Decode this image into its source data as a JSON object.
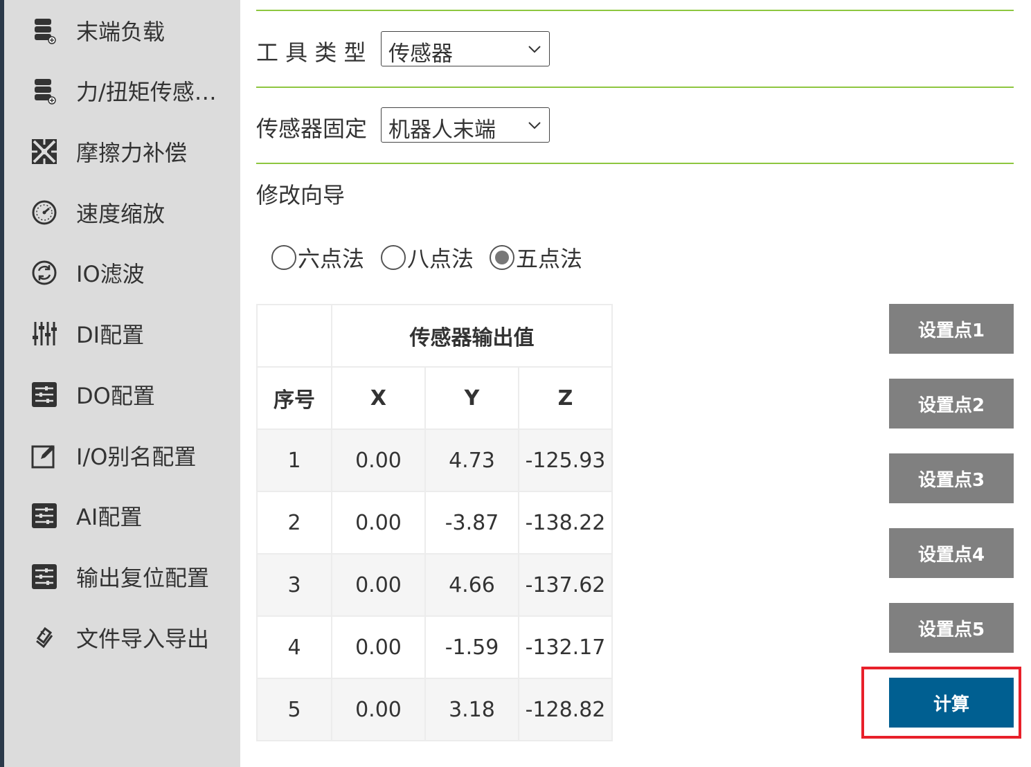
{
  "sidebar": {
    "items": [
      {
        "label": "末端负载",
        "icon": "database-plus-icon"
      },
      {
        "label": "力/扭矩传感…",
        "icon": "database-plus-icon"
      },
      {
        "label": "摩擦力补偿",
        "icon": "grid-pattern-icon"
      },
      {
        "label": "速度缩放",
        "icon": "speedometer-icon"
      },
      {
        "label": "IO滤波",
        "icon": "refresh-circle-icon"
      },
      {
        "label": "DI配置",
        "icon": "sliders-icon"
      },
      {
        "label": "DO配置",
        "icon": "settings-list-icon"
      },
      {
        "label": "I/O别名配置",
        "icon": "edit-icon"
      },
      {
        "label": "AI配置",
        "icon": "settings-list-icon"
      },
      {
        "label": "输出复位配置",
        "icon": "settings-list-icon"
      },
      {
        "label": "文件导入导出",
        "icon": "import-export-icon"
      }
    ]
  },
  "form": {
    "tool_type_label": "工 具 类 型",
    "tool_type_value": "传感器",
    "sensor_mount_label": "传感器固定",
    "sensor_mount_value": "机器人末端",
    "wizard_label": "修改向导",
    "methods": [
      {
        "label": "六点法",
        "selected": false
      },
      {
        "label": "八点法",
        "selected": false
      },
      {
        "label": "五点法",
        "selected": true
      }
    ]
  },
  "table": {
    "group_header": "传感器输出值",
    "columns": [
      "序号",
      "X",
      "Y",
      "Z"
    ],
    "rows": [
      [
        "1",
        "0.00",
        "4.73",
        "-125.93"
      ],
      [
        "2",
        "0.00",
        "-3.87",
        "-138.22"
      ],
      [
        "3",
        "0.00",
        "4.66",
        "-137.62"
      ],
      [
        "4",
        "0.00",
        "-1.59",
        "-132.17"
      ],
      [
        "5",
        "0.00",
        "3.18",
        "-128.82"
      ]
    ]
  },
  "buttons": {
    "set_points": [
      "设置点1",
      "设置点2",
      "设置点3",
      "设置点4",
      "设置点5"
    ],
    "calculate": "计算"
  },
  "colors": {
    "accent_line": "#8dc63f",
    "primary_button": "#005f91",
    "secondary_button": "#808080",
    "highlight": "#e8202a",
    "sidebar": "#dcdcdc"
  }
}
